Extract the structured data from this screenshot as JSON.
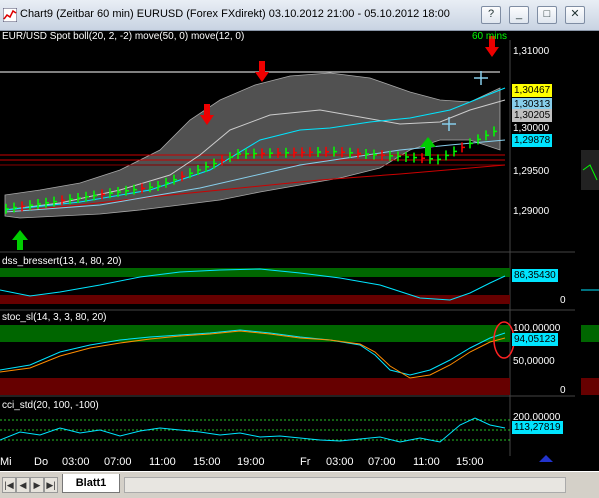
{
  "window": {
    "title": "Chart9 (Zeitbar 60 min)  EURUSD (Forex FXdirekt) 03.10.2012 21:00 - 05.10.2012 18:00",
    "buttons": [
      "?",
      "_",
      "□",
      "✕"
    ]
  },
  "main_panel": {
    "title": "EUR/USD Spot boll(20, 2, -2) move(50, 0) move(12, 0)",
    "timeframe": "60 mins",
    "price_labels": [
      "1,31000",
      "1,30000",
      "1,29500",
      "1,29000"
    ],
    "price_tags": [
      {
        "text": "1,30467",
        "color": "#ffff00"
      },
      {
        "text": "1,30313",
        "color": "#87ceeb"
      },
      {
        "text": "1,30205",
        "color": "#c0c0c0"
      },
      {
        "text": "1,29878",
        "color": "#00e5ff"
      }
    ]
  },
  "dss_panel": {
    "title": "dss_bressert(13, 4, 80, 20)",
    "value": "86,35430",
    "zero": "0"
  },
  "stoc_panel": {
    "title": "stoc_sl(14, 3, 3, 80, 20)",
    "levels": [
      "100,00000",
      "50,00000",
      "0"
    ],
    "value": "94,05123"
  },
  "cci_panel": {
    "title": "cci_std(20, 100, -100)",
    "levels": [
      "200,00000"
    ],
    "value": "113,27819"
  },
  "xaxis": {
    "labels": [
      "Mi",
      "Do",
      "03:00",
      "07:00",
      "11:00",
      "15:00",
      "19:00",
      "Fr",
      "03:00",
      "07:00",
      "11:00",
      "15:00"
    ]
  },
  "bottom": {
    "nav": [
      "|◀",
      "◀",
      "▶",
      "▶|"
    ],
    "sheet_tab": "Blatt1"
  },
  "colors": {
    "bull": "#00ff00",
    "bear": "#ff0000",
    "band_fill": "#555555",
    "band_edge": "#bbbbbb",
    "overbought": "#00aa00",
    "oversold": "#aa0000",
    "signal_up": "#00cc00",
    "signal_down": "#ee0000"
  }
}
